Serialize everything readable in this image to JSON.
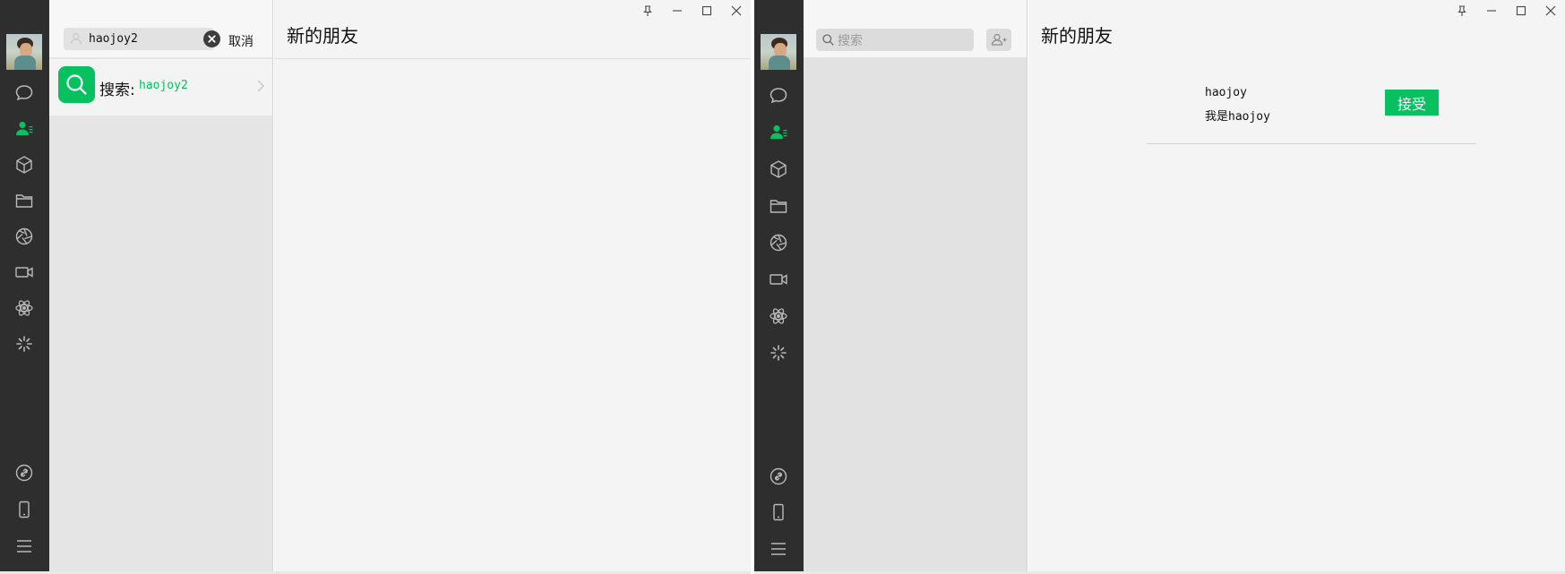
{
  "left": {
    "search": {
      "value": "haojoy2",
      "cancel_label": "取消"
    },
    "result": {
      "label": "搜索:",
      "term": "haojoy2"
    },
    "main": {
      "title": "新的朋友"
    }
  },
  "right": {
    "search": {
      "placeholder": "搜索"
    },
    "main": {
      "title": "新的朋友"
    },
    "friend_request": {
      "name": "haojoy",
      "message": "我是haojoy",
      "accept_label": "接受"
    }
  },
  "colors": {
    "accent": "#07c160",
    "sidebar": "#2e2e2e",
    "pane": "#e5e5e5",
    "main": "#f4f4f4"
  },
  "icons": [
    "chat-icon",
    "contacts-icon",
    "box-icon",
    "folder-icon",
    "aperture-icon",
    "video-icon",
    "atom-icon",
    "spark-icon",
    "link-icon",
    "phone-icon",
    "menu-icon",
    "pin-icon",
    "minimize-icon",
    "maximize-icon",
    "close-icon",
    "search-icon",
    "add-contact-icon",
    "clear-icon",
    "chevron-right-icon"
  ]
}
